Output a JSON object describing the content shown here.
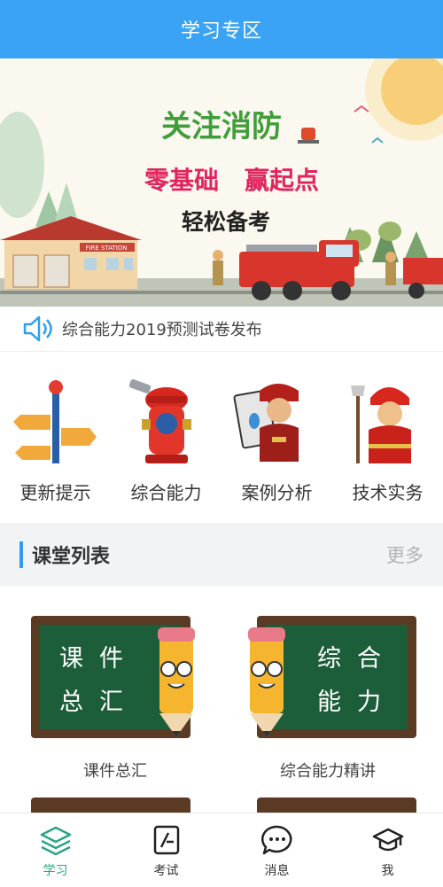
{
  "header": {
    "title": "学习专区"
  },
  "banner": {
    "headline": "关注消防",
    "slogan1": "零基础",
    "slogan2": "赢起点",
    "subline": "轻松备考",
    "station_sign": "FIRE STATION"
  },
  "notice": {
    "text": "综合能力2019预测试卷发布"
  },
  "categories": [
    {
      "label": "更新提示"
    },
    {
      "label": "综合能力"
    },
    {
      "label": "案例分析"
    },
    {
      "label": "技术实务"
    }
  ],
  "section": {
    "title": "课堂列表",
    "more": "更多"
  },
  "courses": [
    {
      "board_line1": "课件",
      "board_line2": "总汇",
      "label": "课件总汇"
    },
    {
      "board_line1": "综合",
      "board_line2": "能力",
      "label": "综合能力精讲"
    }
  ],
  "tabs": [
    {
      "label": "学习",
      "icon": "layers-icon",
      "active": true
    },
    {
      "label": "考试",
      "icon": "exam-sheet-icon"
    },
    {
      "label": "消息",
      "icon": "message-bubble-icon"
    },
    {
      "label": "我",
      "icon": "graduation-cap-icon"
    }
  ],
  "colors": {
    "header": "#3aa3f5",
    "active_tab": "#2aa389",
    "section_bar": "#2e9ff0"
  }
}
